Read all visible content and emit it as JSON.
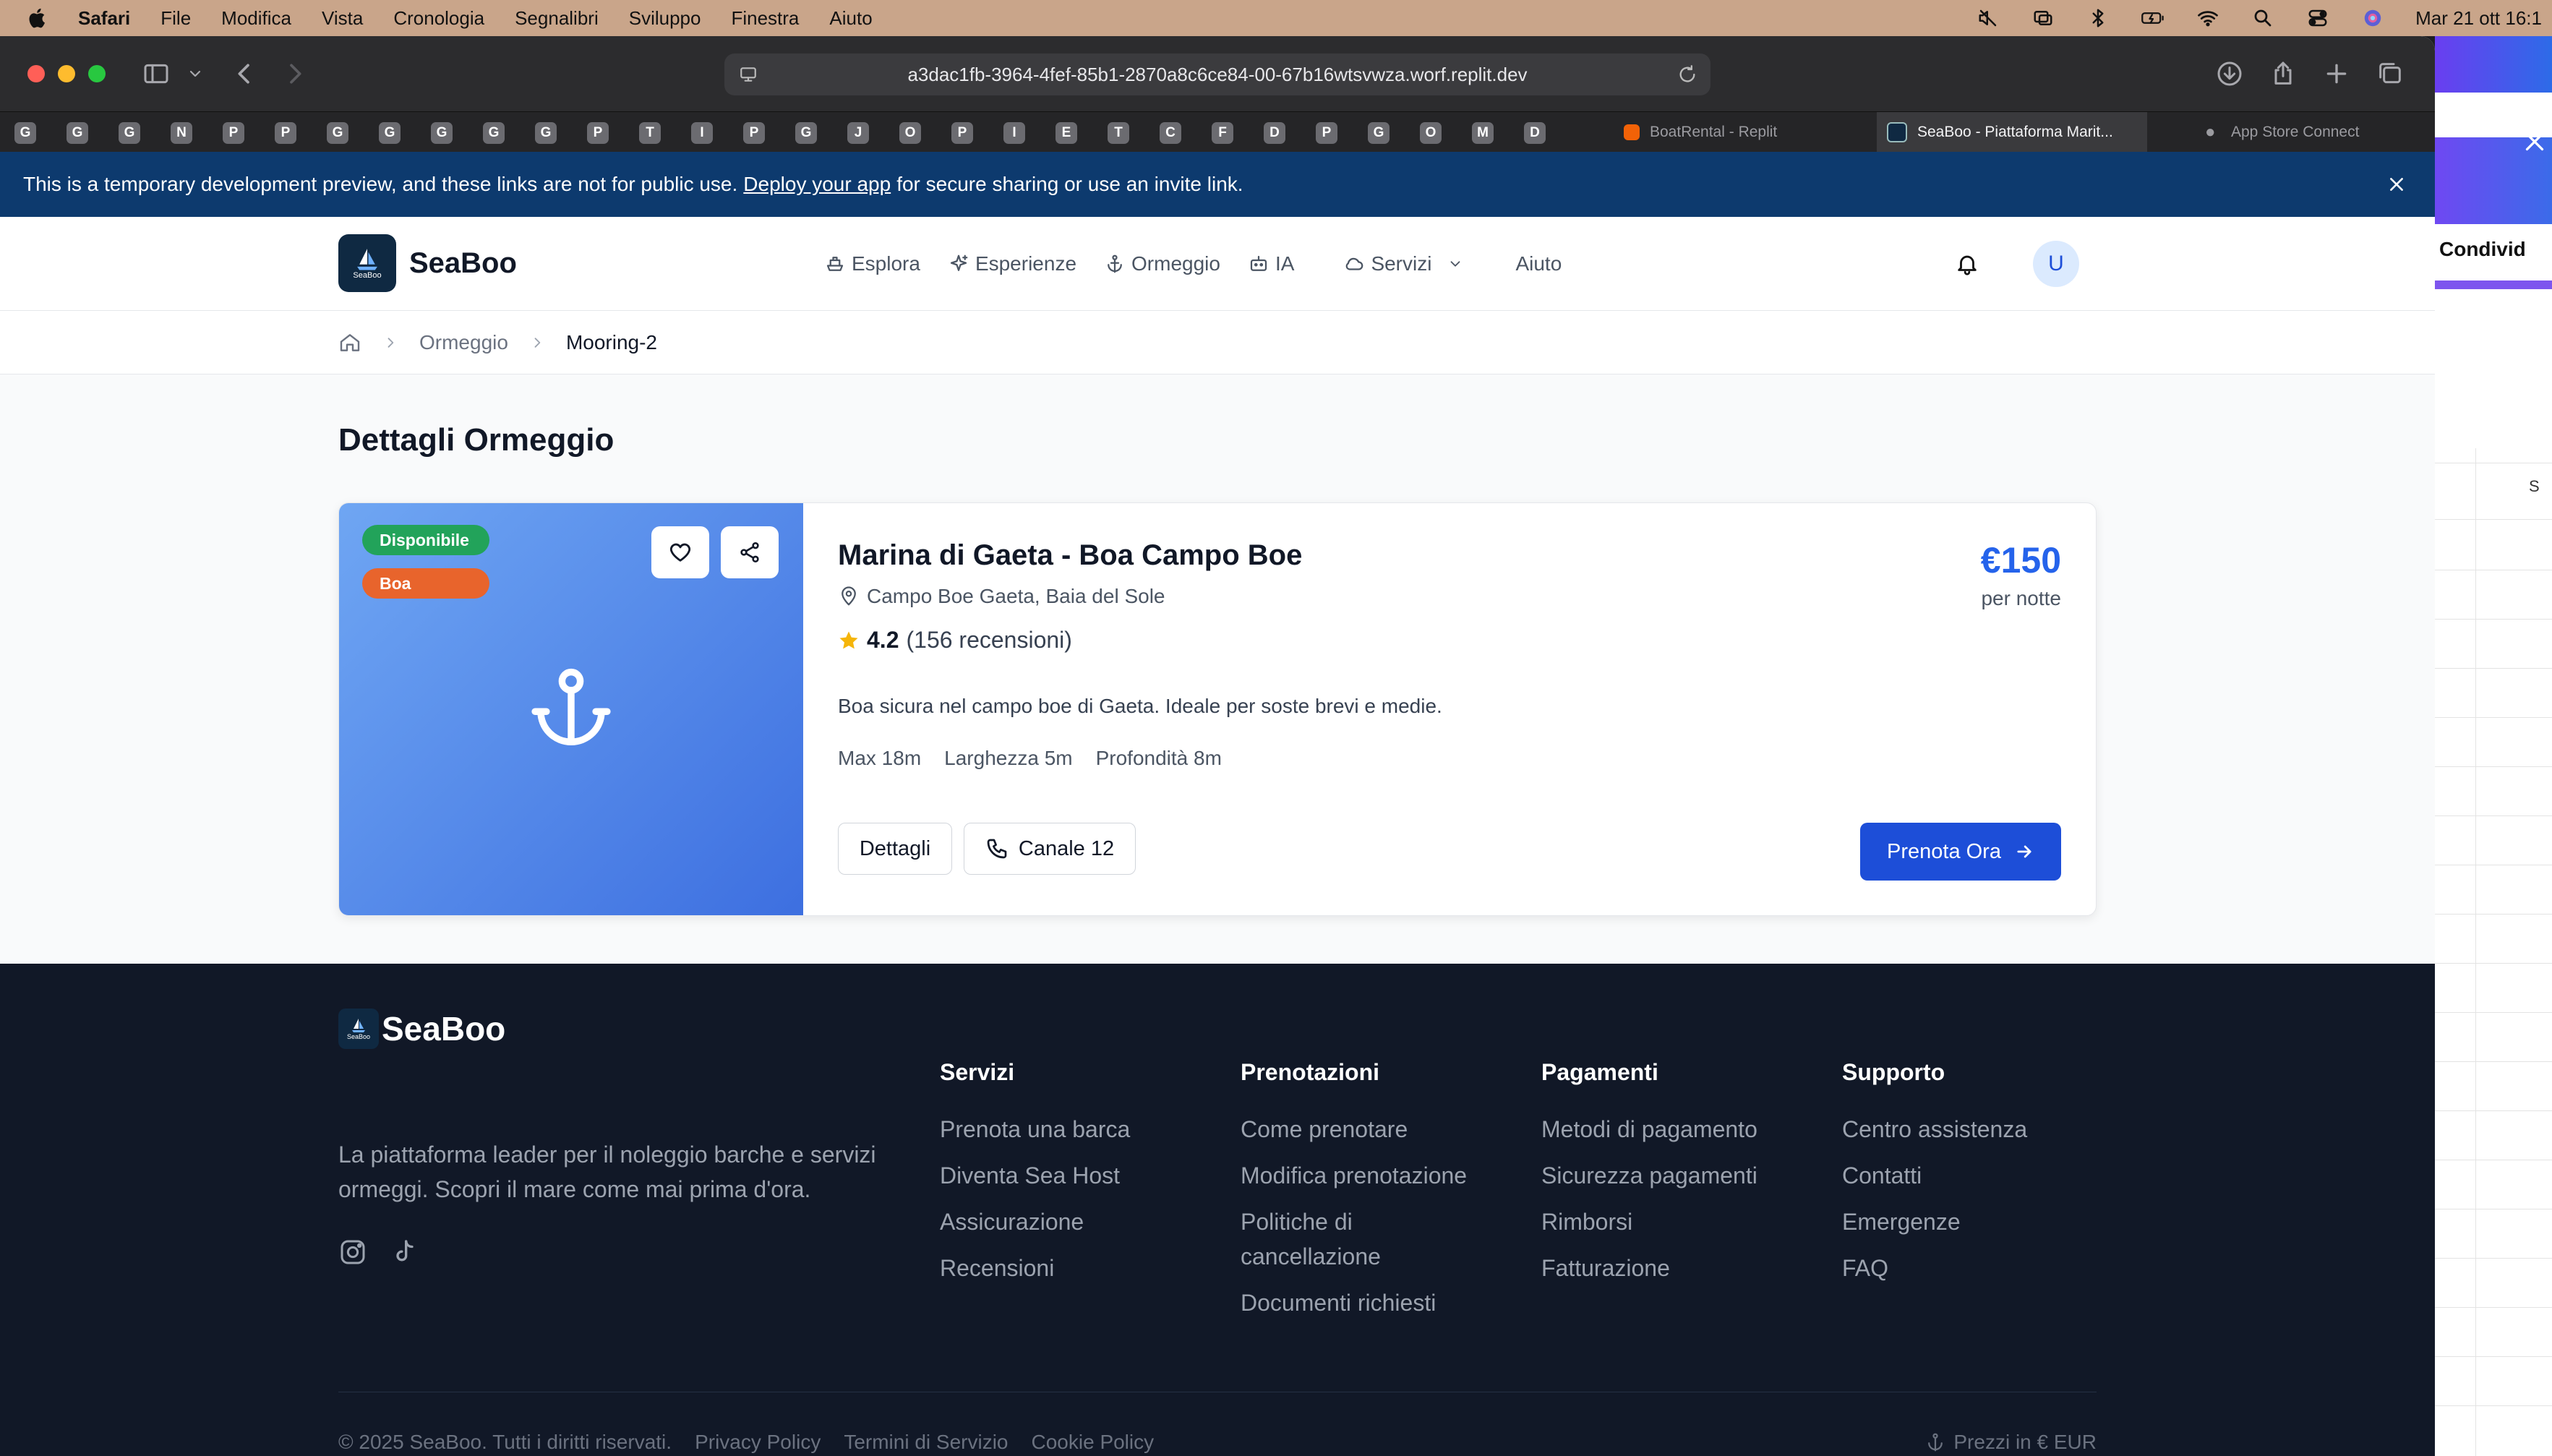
{
  "menubar": {
    "app": "Safari",
    "items": [
      "File",
      "Modifica",
      "Vista",
      "Cronologia",
      "Segnalibri",
      "Sviluppo",
      "Finestra",
      "Aiuto"
    ],
    "clock": "Mar 21 ott  16:1"
  },
  "browser": {
    "url": "a3dac1fb-3964-4fef-85b1-2870a8c6ce84-00-67b16wtsvwza.worf.replit.dev",
    "pinned_tabs": [
      "G",
      "G",
      "G",
      "N",
      "P",
      "P",
      "G",
      "G",
      "G",
      "G",
      "G",
      "P",
      "T",
      "I",
      "P",
      "G",
      "J",
      "O",
      "P",
      "I",
      "E",
      "T",
      "C",
      "F",
      "D",
      "P",
      "G",
      "O",
      "M",
      "D"
    ],
    "tabs": [
      {
        "label": "BoatRental - Replit"
      },
      {
        "label": "SeaBoo - Piattaforma Marit..."
      },
      {
        "label": "App Store Connect"
      }
    ]
  },
  "banner": {
    "text_before": "This is a temporary development preview, and these links are not for public use.",
    "link": "Deploy your app",
    "text_after": "for secure sharing or use an invite link."
  },
  "header": {
    "brand": "SeaBoo",
    "logo_text": "SeaBoo",
    "nav": [
      "Esplora",
      "Esperienze",
      "Ormeggio",
      "IA",
      "Servizi",
      "Aiuto"
    ],
    "avatar": "U"
  },
  "breadcrumb": {
    "items": [
      "Ormeggio",
      "Mooring-2"
    ]
  },
  "page": {
    "title": "Dettagli Ormeggio"
  },
  "mooring": {
    "badges": {
      "status": "Disponibile",
      "type": "Boa"
    },
    "name": "Marina di Gaeta - Boa Campo Boe",
    "location": "Campo Boe Gaeta, Baia del Sole",
    "rating": "4.2",
    "reviews": "(156 recensioni)",
    "description": "Boa sicura nel campo boe di Gaeta. Ideale per soste brevi e medie.",
    "specs": [
      "Max 18m",
      "Larghezza 5m",
      "Profondità 8m"
    ],
    "price": "€150",
    "price_unit": "per notte",
    "details_button": "Dettagli",
    "channel_button": "Canale 12",
    "book_button": "Prenota Ora"
  },
  "footer": {
    "brand": "SeaBoo",
    "tagline": "La piattaforma leader per il noleggio barche e servizi ormeggi. Scopri il mare come mai prima d'ora.",
    "columns": [
      {
        "title": "Servizi",
        "links": [
          "Prenota una barca",
          "Diventa Sea Host",
          "Assicurazione",
          "Recensioni"
        ]
      },
      {
        "title": "Prenotazioni",
        "links": [
          "Come prenotare",
          "Modifica prenotazione",
          "Politiche di cancellazione",
          "Documenti richiesti"
        ]
      },
      {
        "title": "Pagamenti",
        "links": [
          "Metodi di pagamento",
          "Sicurezza pagamenti",
          "Rimborsi",
          "Fatturazione"
        ]
      },
      {
        "title": "Supporto",
        "links": [
          "Centro assistenza",
          "Contatti",
          "Emergenze",
          "FAQ"
        ]
      }
    ],
    "bottom": [
      "© 2025 SeaBoo. Tutti i diritti riservati.",
      "Privacy Policy",
      "Termini di Servizio",
      "Cookie Policy"
    ],
    "currency": "Prezzi in € EUR"
  },
  "background_window": {
    "share": "Condivid",
    "column": "S"
  },
  "colors": {
    "primary": "#1d4ed8",
    "price": "#2563eb",
    "available": "#22a35a",
    "boa": "#e8642c",
    "banner": "#0d3a6e",
    "footer": "#111827"
  }
}
